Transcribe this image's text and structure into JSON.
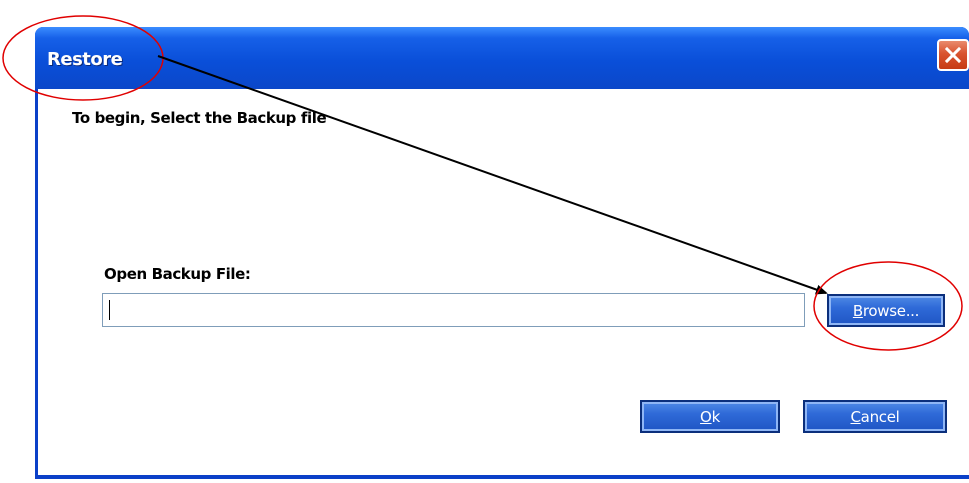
{
  "window": {
    "title": "Restore"
  },
  "dialog": {
    "heading": "To begin, Select the Backup file",
    "field_label": "Open Backup File:",
    "file_path_value": ""
  },
  "buttons": {
    "browse": {
      "accel": "B",
      "rest": "rowse..."
    },
    "ok": {
      "accel": "O",
      "rest": "k"
    },
    "cancel": {
      "accel": "C",
      "rest": "ancel"
    }
  },
  "colors": {
    "titlebar": "#0a4fd9",
    "button": "#2f6ad8",
    "close": "#d9532f",
    "annotation_circle": "#e00000",
    "annotation_arrow": "#000000"
  },
  "icons": {
    "close": "close-icon",
    "annotation": "arrow"
  }
}
